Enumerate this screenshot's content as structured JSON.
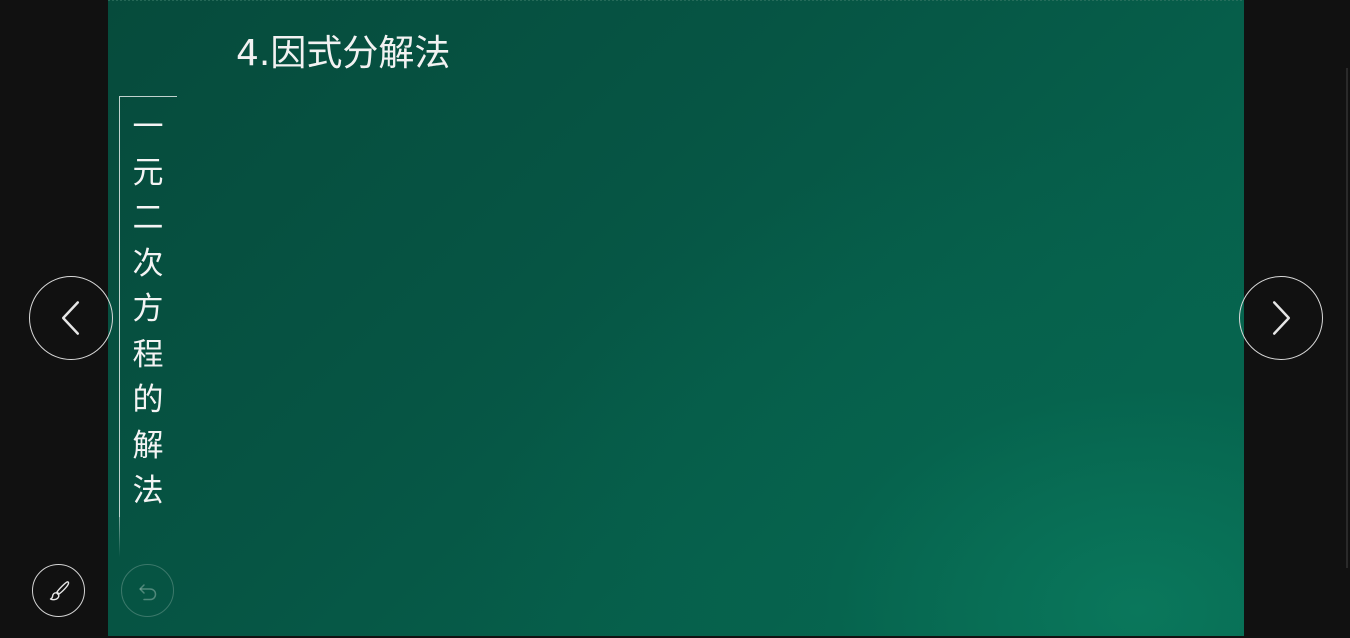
{
  "slide": {
    "title": "4.因式分解法",
    "vertical_label": [
      "一",
      "元",
      "二",
      "次",
      "方",
      "程",
      "的",
      "解",
      "法"
    ]
  },
  "controls": {
    "prev_icon": "chevron-left-icon",
    "next_icon": "chevron-right-icon",
    "pen_icon": "brush-icon",
    "undo_icon": "undo-icon"
  },
  "colors": {
    "viewer_background": "#111111",
    "slide_green_dark": "#064b3c",
    "slide_green_light": "#0a785c",
    "text": "#f2f2f2"
  }
}
